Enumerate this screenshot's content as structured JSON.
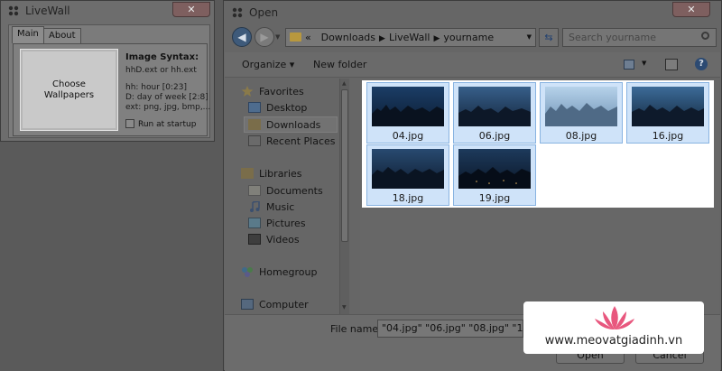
{
  "livewall": {
    "title": "LiveWall",
    "close_label": "✕",
    "tabs": [
      "Main",
      "About"
    ],
    "choose_button": [
      "Choose",
      "Wallpapers"
    ],
    "syntax_title": "Image Syntax:",
    "syntax_lines": [
      "hhD.ext or hh.ext",
      "hh: hour [0:23]",
      "D: day of week [2:8]",
      "ext: png, jpg, bmp,..."
    ],
    "startup_label": "Run at startup",
    "startup_checked": false
  },
  "open_dialog": {
    "title": "Open",
    "close_label": "✕",
    "back_glyph": "◀",
    "forward_glyph": "▶",
    "breadcrumb": [
      "«",
      "Downloads",
      "LiveWall",
      "yourname"
    ],
    "search_placeholder": "Search yourname",
    "toolbar": {
      "organize": "Organize ▾",
      "new_folder": "New folder",
      "help": "?"
    },
    "nav": {
      "favorites": "Favorites",
      "desktop": "Desktop",
      "downloads": "Downloads",
      "recent_places": "Recent Places",
      "libraries": "Libraries",
      "documents": "Documents",
      "music": "Music",
      "pictures": "Pictures",
      "videos": "Videos",
      "homegroup": "Homegroup",
      "computer": "Computer"
    },
    "files": [
      {
        "name": "04.jpg"
      },
      {
        "name": "06.jpg"
      },
      {
        "name": "08.jpg"
      },
      {
        "name": "16.jpg"
      },
      {
        "name": "18.jpg"
      },
      {
        "name": "19.jpg"
      }
    ],
    "filename_label": "File name:",
    "filename_value": "\"04.jpg\" \"06.jpg\" \"08.jpg\" \"16.jpg\" \"",
    "open_label": "Open",
    "cancel_label": "Cancel"
  },
  "watermark": {
    "text": "www.meovatgiadinh.vn"
  },
  "colors": {
    "accent_pink": "#e8577e",
    "selection_blue": "#cfe3f9",
    "overlay_gray": "#666666"
  }
}
